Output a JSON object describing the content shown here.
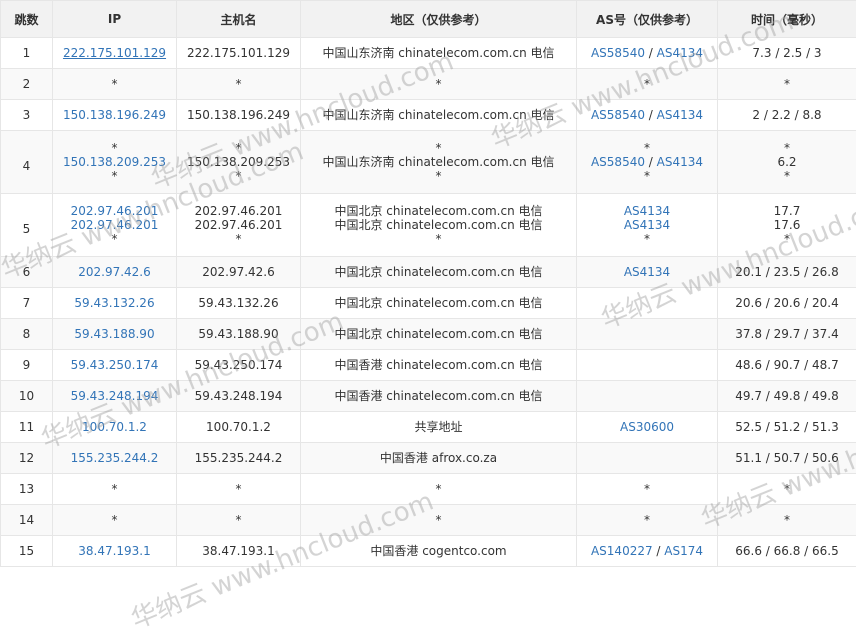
{
  "headers": [
    "跳数",
    "IP",
    "主机名",
    "地区（仅供参考）",
    "AS号（仅供参考）",
    "时间（毫秒）"
  ],
  "rows": [
    {
      "hop": "1",
      "ip": [
        "222.175.101.129"
      ],
      "ip_link": true,
      "host": [
        "222.175.101.129"
      ],
      "region": [
        "中国山东济南 chinatelecom.com.cn 电信"
      ],
      "as": [
        [
          "AS58540",
          "AS4134"
        ]
      ],
      "time": [
        "7.3 / 2.5 / 3"
      ]
    },
    {
      "hop": "2",
      "ip": [
        "*"
      ],
      "host": [
        "*"
      ],
      "region": [
        "*"
      ],
      "as": [
        [
          "*"
        ]
      ],
      "time": [
        "*"
      ]
    },
    {
      "hop": "3",
      "ip": [
        "150.138.196.249"
      ],
      "host": [
        "150.138.196.249"
      ],
      "region": [
        "中国山东济南 chinatelecom.com.cn 电信"
      ],
      "as": [
        [
          "AS58540",
          "AS4134"
        ]
      ],
      "time": [
        "2 / 2.2 / 8.8"
      ]
    },
    {
      "hop": "4",
      "ip": [
        "*",
        "150.138.209.253",
        "*"
      ],
      "host": [
        "*",
        "150.138.209.253",
        "*"
      ],
      "region": [
        "*",
        "中国山东济南 chinatelecom.com.cn 电信",
        "*"
      ],
      "as": [
        [
          "*"
        ],
        [
          "AS58540",
          "AS4134"
        ],
        [
          "*"
        ]
      ],
      "time": [
        "*",
        "6.2",
        "*"
      ]
    },
    {
      "hop": "5",
      "ip": [
        "202.97.46.201",
        "202.97.46.201",
        "*"
      ],
      "host": [
        "202.97.46.201",
        "202.97.46.201",
        "*"
      ],
      "region": [
        "中国北京 chinatelecom.com.cn 电信",
        "中国北京 chinatelecom.com.cn 电信",
        "*"
      ],
      "as": [
        [
          "AS4134"
        ],
        [
          "AS4134"
        ],
        [
          "*"
        ]
      ],
      "time": [
        "17.7",
        "17.6",
        "*"
      ]
    },
    {
      "hop": "6",
      "ip": [
        "202.97.42.6"
      ],
      "host": [
        "202.97.42.6"
      ],
      "region": [
        "中国北京 chinatelecom.com.cn 电信"
      ],
      "as": [
        [
          "AS4134"
        ]
      ],
      "time": [
        "20.1 / 23.5 / 26.8"
      ]
    },
    {
      "hop": "7",
      "ip": [
        "59.43.132.26"
      ],
      "host": [
        "59.43.132.26"
      ],
      "region": [
        "中国北京 chinatelecom.com.cn 电信"
      ],
      "as": [],
      "time": [
        "20.6 / 20.6 / 20.4"
      ]
    },
    {
      "hop": "8",
      "ip": [
        "59.43.188.90"
      ],
      "host": [
        "59.43.188.90"
      ],
      "region": [
        "中国北京 chinatelecom.com.cn 电信"
      ],
      "as": [],
      "time": [
        "37.8 / 29.7 / 37.4"
      ]
    },
    {
      "hop": "9",
      "ip": [
        "59.43.250.174"
      ],
      "host": [
        "59.43.250.174"
      ],
      "region": [
        "中国香港 chinatelecom.com.cn 电信"
      ],
      "as": [],
      "time": [
        "48.6 / 90.7 / 48.7"
      ]
    },
    {
      "hop": "10",
      "ip": [
        "59.43.248.194"
      ],
      "host": [
        "59.43.248.194"
      ],
      "region": [
        "中国香港 chinatelecom.com.cn 电信"
      ],
      "as": [],
      "time": [
        "49.7 / 49.8 / 49.8"
      ]
    },
    {
      "hop": "11",
      "ip": [
        "100.70.1.2"
      ],
      "host": [
        "100.70.1.2"
      ],
      "region": [
        "共享地址"
      ],
      "as": [
        [
          "AS30600"
        ]
      ],
      "time": [
        "52.5 / 51.2 / 51.3"
      ]
    },
    {
      "hop": "12",
      "ip": [
        "155.235.244.2"
      ],
      "host": [
        "155.235.244.2"
      ],
      "region": [
        "中国香港 afrox.co.za"
      ],
      "as": [],
      "time": [
        "51.1 / 50.7 / 50.6"
      ]
    },
    {
      "hop": "13",
      "ip": [
        "*"
      ],
      "host": [
        "*"
      ],
      "region": [
        "*"
      ],
      "as": [
        [
          "*"
        ]
      ],
      "time": [
        "*"
      ]
    },
    {
      "hop": "14",
      "ip": [
        "*"
      ],
      "host": [
        "*"
      ],
      "region": [
        "*"
      ],
      "as": [
        [
          "*"
        ]
      ],
      "time": [
        "*"
      ]
    },
    {
      "hop": "15",
      "ip": [
        "38.47.193.1"
      ],
      "host": [
        "38.47.193.1"
      ],
      "region": [
        "中国香港 cogentco.com"
      ],
      "as": [
        [
          "AS140227",
          "AS174"
        ]
      ],
      "time": [
        "66.6 / 66.8 / 66.5"
      ]
    }
  ],
  "watermark": {
    "text": "华纳云 www.hncloud.com"
  },
  "colors": {
    "link": "#3274b7",
    "header_bg": "#f2f2f2",
    "stripe": "#f9f9f9",
    "border": "#e6e6e6"
  }
}
